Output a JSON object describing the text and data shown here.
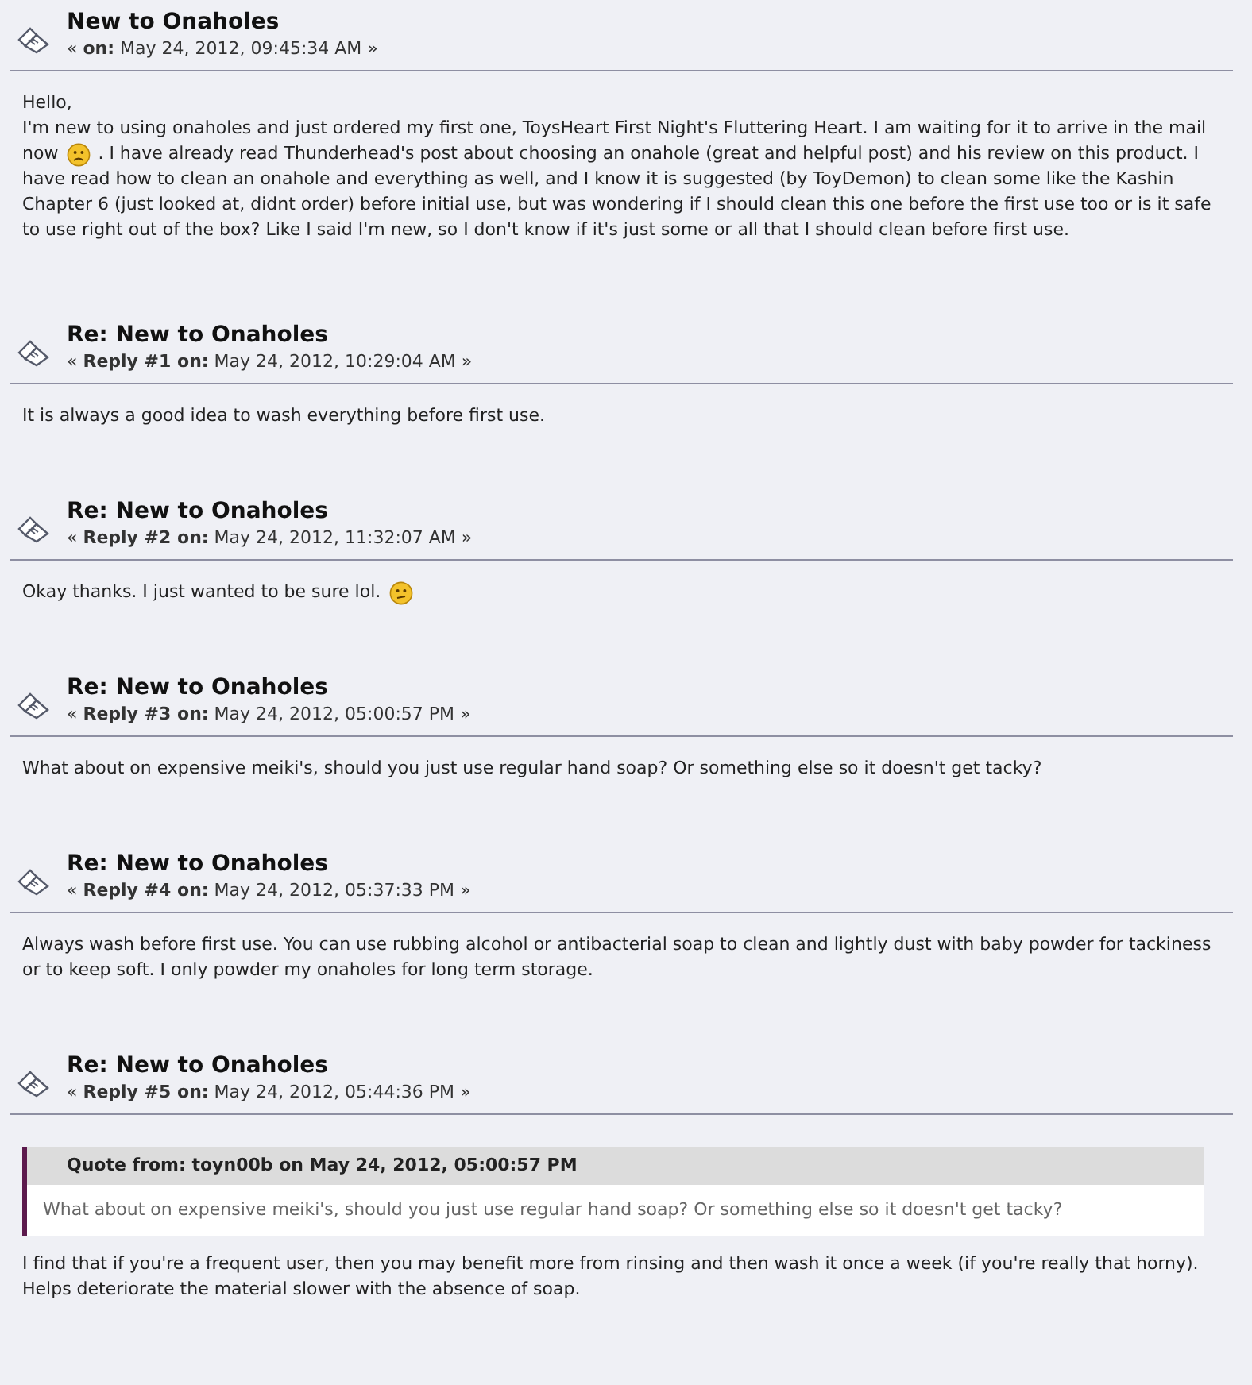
{
  "posts": [
    {
      "title": "New to Onaholes",
      "meta": "« **on:** May 24, 2012, 09:45:34 AM »",
      "body": [
        {
          "kind": "para",
          "text": "Hello,"
        },
        {
          "kind": "line",
          "parts": [
            {
              "kind": "text",
              "text": "I'm new to using onaholes and just ordered my first one, ToysHeart First Night's Fluttering Heart. I am waiting for it to arrive in the mail"
            }
          ]
        },
        {
          "kind": "line",
          "parts": [
            {
              "kind": "text",
              "text": "now"
            },
            {
              "kind": "frown"
            },
            {
              "kind": "text",
              "text": ". I have already read Thunderhead's post about choosing an onahole (great and helpful post) and his review on this product. I"
            }
          ]
        },
        {
          "kind": "para",
          "text": "have read how to clean an onahole and everything as well, and I know it is suggested (by ToyDemon) to clean some like the Kashin Chapter 6 (just looked at, didnt order) before initial use, but was wondering if I should clean this one before the first use too or is it safe to use right out of the box? Like I said I'm new, so I don't know if it's just some or all that I should clean before first use."
        }
      ]
    },
    {
      "title": "Re: New to Onaholes",
      "meta": "« **Reply #1 on:** May 24, 2012, 10:29:04 AM »",
      "body": [
        {
          "kind": "para",
          "text": "It is always a good idea to wash everything before first use."
        }
      ]
    },
    {
      "title": "Re: New to Onaholes",
      "meta": "« **Reply #2 on:** May 24, 2012, 11:32:07 AM »",
      "body": [
        {
          "kind": "line",
          "parts": [
            {
              "kind": "text",
              "text": "Okay thanks. I just wanted to be sure lol."
            },
            {
              "kind": "unsure"
            }
          ]
        }
      ]
    },
    {
      "title": "Re: New to Onaholes",
      "meta": "« **Reply #3 on:** May 24, 2012, 05:00:57 PM »",
      "body": [
        {
          "kind": "para",
          "text": "What about on expensive meiki's, should you just use regular hand soap?  Or something else so it doesn't get tacky?"
        }
      ]
    },
    {
      "title": "Re: New to Onaholes",
      "meta": "« **Reply #4 on:** May 24, 2012, 05:37:33 PM »",
      "body": [
        {
          "kind": "para",
          "text": "Always wash before first use. You can use rubbing alcohol or antibacterial soap to clean and lightly dust with baby powder for tackiness or to keep soft. I only powder my onaholes for long term storage."
        }
      ]
    },
    {
      "title": "Re: New to Onaholes",
      "meta": "« **Reply #5 on:** May 24, 2012, 05:44:36 PM »",
      "body": [
        {
          "kind": "quote",
          "header": "Quote from: toyn00b on May 24, 2012, 05:00:57 PM",
          "text": "What about on expensive meiki's, should you just use regular hand soap?  Or something else so it doesn't get tacky?"
        },
        {
          "kind": "para",
          "text": "I find that if you're a frequent user, then you may benefit more from rinsing and then wash it once a week (if you're really that horny). Helps deteriorate the material slower with the absence of soap."
        }
      ]
    }
  ]
}
